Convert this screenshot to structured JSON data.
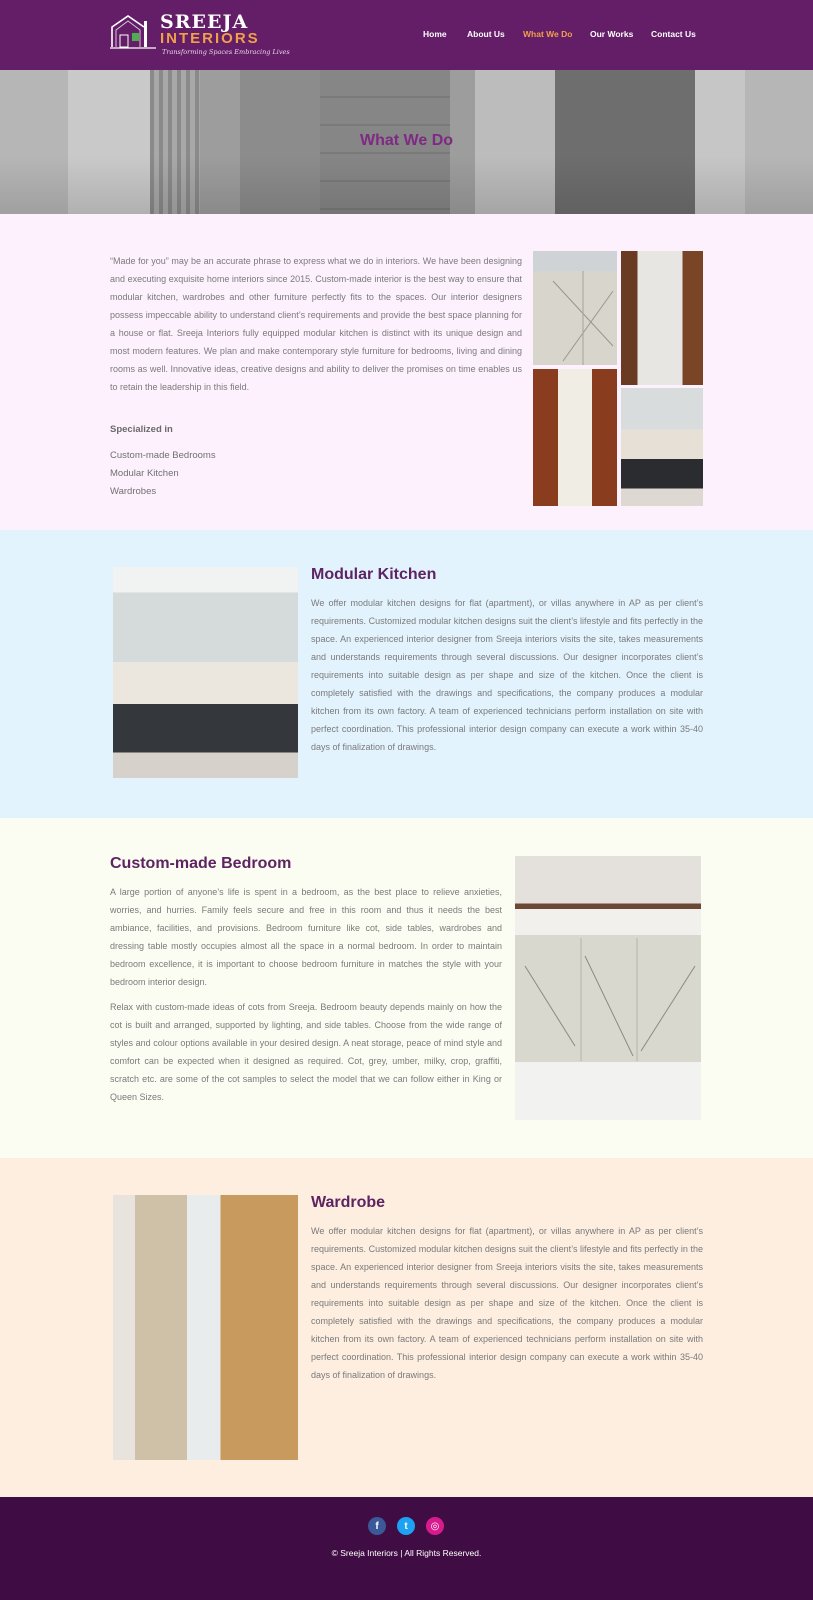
{
  "header": {
    "logo": {
      "brand": "SREEJA",
      "sub": "INTERIORS",
      "tagline": "Transforming Spaces Embracing Lives"
    },
    "nav": [
      {
        "label": "Home",
        "active": false
      },
      {
        "label": "About Us",
        "active": false
      },
      {
        "label": "What We Do",
        "active": true
      },
      {
        "label": "Our Works",
        "active": false
      },
      {
        "label": "Contact Us",
        "active": false
      }
    ]
  },
  "hero": {
    "title": "What We Do"
  },
  "intro": {
    "paragraph": "“Made for you” may be an accurate phrase to express what we do in interiors. We have been designing and executing exquisite home interiors since 2015. Custom-made interior is the best way to ensure that modular kitchen, wardrobes and other furniture perfectly fits to the spaces. Our interior designers possess impeccable ability to understand client’s requirements and provide the best space planning for a house or flat. Sreeja Interiors fully equipped modular kitchen is distinct with its unique design and most modern features. We plan and make contemporary style furniture for bedrooms, living and dining rooms as well. Innovative ideas, creative designs and ability to deliver the promises on time enables us to retain the leadership in this field.",
    "specialized_title": "Specialized in",
    "specialized_items": [
      "Custom-made Bedrooms",
      "Modular Kitchen",
      "Wardrobes"
    ]
  },
  "modular_kitchen": {
    "title": "Modular Kitchen",
    "paragraph": "We offer modular kitchen designs for flat (apartment), or villas anywhere in  AP as per client’s requirements. Customized modular kitchen designs suit the client’s lifestyle and fits perfectly in the space. An experienced interior designer from Sreeja interiors visits the site, takes measurements and understands requirements through several discussions. Our designer incorporates client’s requirements into suitable design as per shape and size of the kitchen. Once the client is completely satisfied with the drawings and specifications, the company produces a modular kitchen from its own factory. A team of experienced technicians perform installation on site with perfect coordination. This professional interior design company can execute a work within 35-40 days of finalization of drawings."
  },
  "bedroom": {
    "title": "Custom-made Bedroom",
    "paragraph1": "A large portion of anyone’s life is spent in a bedroom, as the best place to relieve anxieties, worries, and hurries. Family feels secure and free in this room and thus it needs the best ambiance, facilities, and provisions. Bedroom furniture like cot, side tables, wardrobes and dressing table mostly occupies almost all the space in a normal bedroom. In order to maintain bedroom excellence, it is important to choose bedroom furniture in matches the style with your bedroom interior design.",
    "paragraph2": "Relax with custom-made ideas of cots from Sreeja. Bedroom beauty depends mainly on how the cot is built and arranged, supported by lighting, and side tables. Choose from the wide range of styles and colour options available in your desired design. A neat storage, peace of mind style and comfort can be expected when it designed as required. Cot, grey, umber, milky, crop, graffiti, scratch etc. are some of the cot samples to select the model that we can follow either in King or Queen Sizes."
  },
  "wardrobe": {
    "title": "Wardrobe",
    "paragraph": "We offer modular kitchen designs for flat (apartment), or villas anywhere in  AP as per client’s requirements. Customized modular kitchen designs suit the client’s lifestyle and fits perfectly in the space. An experienced interior designer from Sreeja interiors visits the site, takes measurements and understands requirements through several discussions. Our designer incorporates client’s requirements into suitable design as per shape and size of the kitchen. Once the client is completely satisfied with the drawings and specifications, the company produces a modular kitchen from its own factory. A team of experienced technicians perform installation on site with perfect coordination. This professional interior design company can execute a work within 35-40 days of finalization of drawings."
  },
  "footer": {
    "social": [
      {
        "icon": "facebook-icon",
        "glyph": "f",
        "color": "#3b5998"
      },
      {
        "icon": "twitter-icon",
        "glyph": "t",
        "color": "#1da1f2"
      },
      {
        "icon": "instagram-icon",
        "glyph": "◎",
        "color": "#d81b8c"
      }
    ],
    "copyright": "© Sreeja Interiors | All Rights Reserved."
  },
  "colors": {
    "header_bg": "#641d67",
    "accent": "#f0a04a",
    "heading": "#5e2462",
    "footer_bg": "#3f0d43"
  }
}
